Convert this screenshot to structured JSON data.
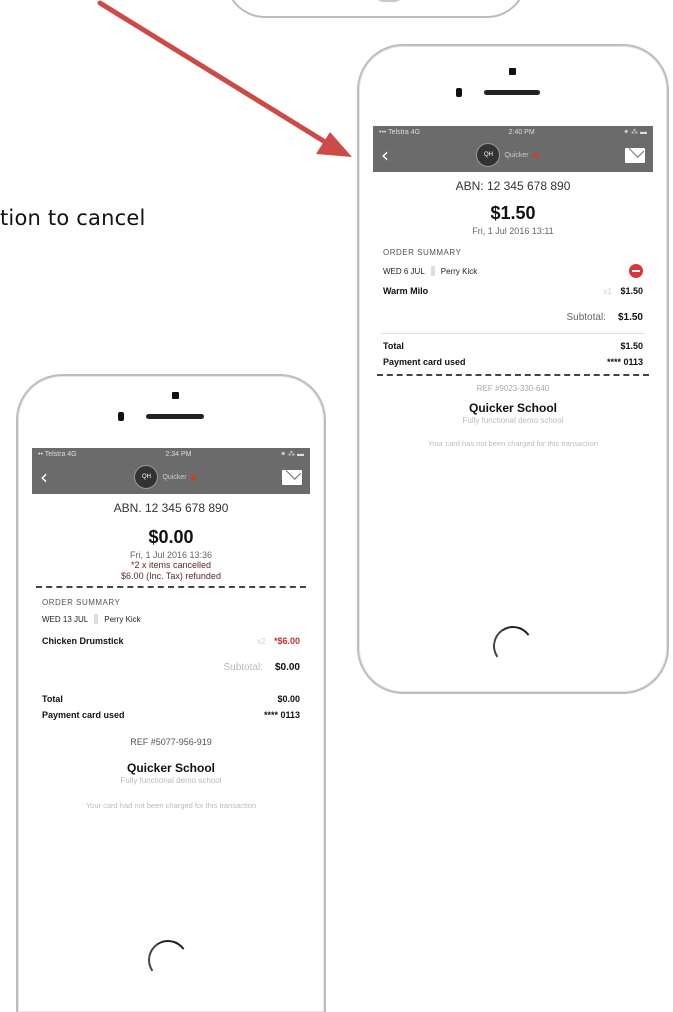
{
  "annotation": {
    "text": "tion to cancel"
  },
  "colors": {
    "arrow": "#cd4b47",
    "header": "#6b6b6b",
    "cancel_red": "#d9363e"
  },
  "phone_after": {
    "status": {
      "carrier": "••• Telstra  4G",
      "time": "2:40 PM",
      "battery": "⁕ ⁂ ▬"
    },
    "header": {
      "logo_text": "QH",
      "brand": "Quicker"
    },
    "abn": "ABN: 12 345 678 890",
    "amount": "$1.50",
    "datetime": "Fri, 1 Jul 2016 13:11",
    "section": "ORDER SUMMARY",
    "order_date": "WED 6 JUL",
    "student": "Perry Kick",
    "item": {
      "name": "Warm Milo",
      "qty": "x1",
      "price": "$1.50"
    },
    "subtotal": {
      "label": "Subtotal:",
      "value": "$1.50"
    },
    "total": {
      "label": "Total",
      "value": "$1.50"
    },
    "payment": {
      "label": "Payment card used",
      "value": "**** 0113"
    },
    "ref": "REF #9023-330-640",
    "school": "Quicker School",
    "school_sub": "Fully functional demo school",
    "note": "Your card has not been charged for this transaction"
  },
  "phone_before": {
    "status": {
      "carrier": "•• Telstra  4G",
      "time": "2:34 PM",
      "battery": "⁕ ⁂ ▬"
    },
    "header": {
      "logo_text": "QH",
      "brand": "Quicker"
    },
    "abn": "ABN. 12 345 678 890",
    "amount": "$0.00",
    "datetime": "Fri, 1 Jul 2016 13:36",
    "cancel_line1": "*2 x items cancelled",
    "cancel_line2": "$6.00 (Inc. Tax) refunded",
    "section": "ORDER SUMMARY",
    "order_date": "WED 13 JUL",
    "student": "Perry Kick",
    "item": {
      "name": "Chicken Drumstick",
      "qty": "x2",
      "price": "*$6.00"
    },
    "subtotal": {
      "label": "Subtotal:",
      "value": "$0.00"
    },
    "total": {
      "label": "Total",
      "value": "$0.00"
    },
    "payment": {
      "label": "Payment card used",
      "value": "**** 0113"
    },
    "ref": "REF #5077-956-919",
    "school": "Quicker School",
    "school_sub": "Fully functional demo school",
    "note": "Your card had not been charged for this transaction"
  }
}
